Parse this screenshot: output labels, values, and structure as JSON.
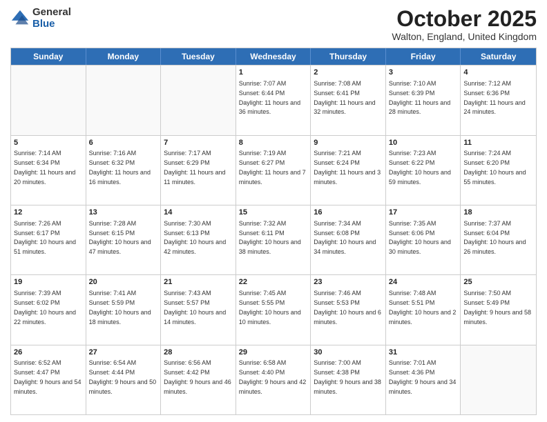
{
  "logo": {
    "general": "General",
    "blue": "Blue"
  },
  "header": {
    "month": "October 2025",
    "location": "Walton, England, United Kingdom"
  },
  "days": [
    "Sunday",
    "Monday",
    "Tuesday",
    "Wednesday",
    "Thursday",
    "Friday",
    "Saturday"
  ],
  "rows": [
    [
      {
        "day": "",
        "empty": true
      },
      {
        "day": "",
        "empty": true
      },
      {
        "day": "",
        "empty": true
      },
      {
        "day": "1",
        "sunrise": "7:07 AM",
        "sunset": "6:44 PM",
        "daylight": "11 hours and 36 minutes."
      },
      {
        "day": "2",
        "sunrise": "7:08 AM",
        "sunset": "6:41 PM",
        "daylight": "11 hours and 32 minutes."
      },
      {
        "day": "3",
        "sunrise": "7:10 AM",
        "sunset": "6:39 PM",
        "daylight": "11 hours and 28 minutes."
      },
      {
        "day": "4",
        "sunrise": "7:12 AM",
        "sunset": "6:36 PM",
        "daylight": "11 hours and 24 minutes."
      }
    ],
    [
      {
        "day": "5",
        "sunrise": "7:14 AM",
        "sunset": "6:34 PM",
        "daylight": "11 hours and 20 minutes."
      },
      {
        "day": "6",
        "sunrise": "7:16 AM",
        "sunset": "6:32 PM",
        "daylight": "11 hours and 16 minutes."
      },
      {
        "day": "7",
        "sunrise": "7:17 AM",
        "sunset": "6:29 PM",
        "daylight": "11 hours and 11 minutes."
      },
      {
        "day": "8",
        "sunrise": "7:19 AM",
        "sunset": "6:27 PM",
        "daylight": "11 hours and 7 minutes."
      },
      {
        "day": "9",
        "sunrise": "7:21 AM",
        "sunset": "6:24 PM",
        "daylight": "11 hours and 3 minutes."
      },
      {
        "day": "10",
        "sunrise": "7:23 AM",
        "sunset": "6:22 PM",
        "daylight": "10 hours and 59 minutes."
      },
      {
        "day": "11",
        "sunrise": "7:24 AM",
        "sunset": "6:20 PM",
        "daylight": "10 hours and 55 minutes."
      }
    ],
    [
      {
        "day": "12",
        "sunrise": "7:26 AM",
        "sunset": "6:17 PM",
        "daylight": "10 hours and 51 minutes."
      },
      {
        "day": "13",
        "sunrise": "7:28 AM",
        "sunset": "6:15 PM",
        "daylight": "10 hours and 47 minutes."
      },
      {
        "day": "14",
        "sunrise": "7:30 AM",
        "sunset": "6:13 PM",
        "daylight": "10 hours and 42 minutes."
      },
      {
        "day": "15",
        "sunrise": "7:32 AM",
        "sunset": "6:11 PM",
        "daylight": "10 hours and 38 minutes."
      },
      {
        "day": "16",
        "sunrise": "7:34 AM",
        "sunset": "6:08 PM",
        "daylight": "10 hours and 34 minutes."
      },
      {
        "day": "17",
        "sunrise": "7:35 AM",
        "sunset": "6:06 PM",
        "daylight": "10 hours and 30 minutes."
      },
      {
        "day": "18",
        "sunrise": "7:37 AM",
        "sunset": "6:04 PM",
        "daylight": "10 hours and 26 minutes."
      }
    ],
    [
      {
        "day": "19",
        "sunrise": "7:39 AM",
        "sunset": "6:02 PM",
        "daylight": "10 hours and 22 minutes."
      },
      {
        "day": "20",
        "sunrise": "7:41 AM",
        "sunset": "5:59 PM",
        "daylight": "10 hours and 18 minutes."
      },
      {
        "day": "21",
        "sunrise": "7:43 AM",
        "sunset": "5:57 PM",
        "daylight": "10 hours and 14 minutes."
      },
      {
        "day": "22",
        "sunrise": "7:45 AM",
        "sunset": "5:55 PM",
        "daylight": "10 hours and 10 minutes."
      },
      {
        "day": "23",
        "sunrise": "7:46 AM",
        "sunset": "5:53 PM",
        "daylight": "10 hours and 6 minutes."
      },
      {
        "day": "24",
        "sunrise": "7:48 AM",
        "sunset": "5:51 PM",
        "daylight": "10 hours and 2 minutes."
      },
      {
        "day": "25",
        "sunrise": "7:50 AM",
        "sunset": "5:49 PM",
        "daylight": "9 hours and 58 minutes."
      }
    ],
    [
      {
        "day": "26",
        "sunrise": "6:52 AM",
        "sunset": "4:47 PM",
        "daylight": "9 hours and 54 minutes."
      },
      {
        "day": "27",
        "sunrise": "6:54 AM",
        "sunset": "4:44 PM",
        "daylight": "9 hours and 50 minutes."
      },
      {
        "day": "28",
        "sunrise": "6:56 AM",
        "sunset": "4:42 PM",
        "daylight": "9 hours and 46 minutes."
      },
      {
        "day": "29",
        "sunrise": "6:58 AM",
        "sunset": "4:40 PM",
        "daylight": "9 hours and 42 minutes."
      },
      {
        "day": "30",
        "sunrise": "7:00 AM",
        "sunset": "4:38 PM",
        "daylight": "9 hours and 38 minutes."
      },
      {
        "day": "31",
        "sunrise": "7:01 AM",
        "sunset": "4:36 PM",
        "daylight": "9 hours and 34 minutes."
      },
      {
        "day": "",
        "empty": true
      }
    ]
  ]
}
